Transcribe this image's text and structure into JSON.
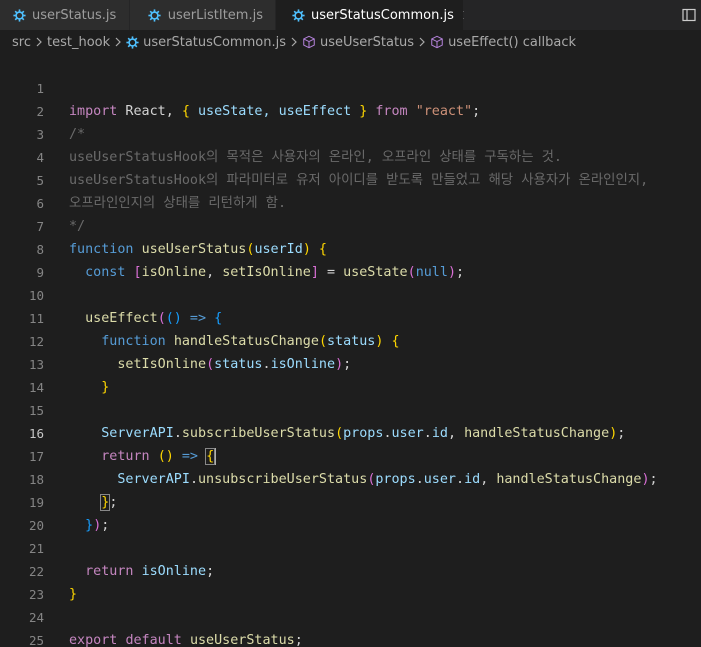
{
  "tabs": [
    {
      "label": "userStatus.js",
      "active": false
    },
    {
      "label": "userListItem.js",
      "active": false
    },
    {
      "label": "userStatusCommon.js",
      "active": true
    }
  ],
  "breadcrumb": {
    "items": [
      "src",
      "test_hook",
      "userStatusCommon.js",
      "useUserStatus",
      "useEffect() callback"
    ]
  },
  "editor": {
    "current_line": 16,
    "line_numbers": [
      "1",
      "2",
      "3",
      "4",
      "5",
      "6",
      "7",
      "8",
      "9",
      "10",
      "11",
      "12",
      "13",
      "14",
      "15",
      "16",
      "17",
      "18",
      "19",
      "20",
      "21",
      "22",
      "23",
      "24",
      "25"
    ],
    "lines": {
      "l1": {
        "a": "import",
        "b": " React, ",
        "c": "{",
        "d": " useState, useEffect ",
        "e": "}",
        "f": " from ",
        "g": "\"react\"",
        "h": ";"
      },
      "l2": "/*",
      "l3": "useUserStatusHook의 목적은 사용자의 온라인, 오프라인 상태를 구독하는 것.",
      "l4": "useUserStatusHook의 파라미터로 유저 아이디를 받도록 만들었고 해당 사용자가 온라인인지,",
      "l5": "오프라인인지의 상태를 리턴하게 함.",
      "l6": "*/",
      "l7": {
        "a": "function",
        "b": " ",
        "c": "useUserStatus",
        "d": "(",
        "e": "userId",
        "f": ")",
        "g": " {"
      },
      "l8": {
        "a": "  ",
        "b": "const",
        "c": " ",
        "d": "[",
        "e": "isOnline",
        "f": ", ",
        "g": "setIsOnline",
        "h": "]",
        "i": " = ",
        "j": "useState",
        "k": "(",
        "l": "null",
        "m": ")",
        "n": ";"
      },
      "l10": {
        "a": "  ",
        "b": "useEffect",
        "c": "(",
        "d": "()",
        "e": " => ",
        "f": "{"
      },
      "l11": {
        "a": "    ",
        "b": "function",
        "c": " ",
        "d": "handleStatusChange",
        "e": "(",
        "f": "status",
        "g": ")",
        "h": " ",
        "i": "{"
      },
      "l12": {
        "a": "      ",
        "b": "setIsOnline",
        "c": "(",
        "d": "status",
        "e": ".",
        "f": "isOnline",
        "g": ")",
        "h": ";"
      },
      "l13": {
        "a": "    ",
        "b": "}"
      },
      "l15": {
        "a": "    ",
        "b": "ServerAPI",
        "c": ".",
        "d": "subscribeUserStatus",
        "e": "(",
        "f": "props",
        "g": ".",
        "h": "user",
        "i": ".",
        "j": "id",
        "k": ", ",
        "l": "handleStatusChange",
        "m": ")",
        "n": ";"
      },
      "l16": {
        "a": "    ",
        "b": "return",
        "c": " ",
        "d": "()",
        "e": " => ",
        "f": "{"
      },
      "l17": {
        "a": "      ",
        "b": "ServerAPI",
        "c": ".",
        "d": "unsubscribeUserStatus",
        "e": "(",
        "f": "props",
        "g": ".",
        "h": "user",
        "i": ".",
        "j": "id",
        "k": ", ",
        "l": "handleStatusChange",
        "m": ")",
        "n": ";"
      },
      "l18": {
        "a": "    ",
        "b": "}",
        "c": ";"
      },
      "l19": {
        "a": "  ",
        "b": "}",
        "c": ")",
        "d": ";"
      },
      "l21": {
        "a": "  ",
        "b": "return",
        "c": " ",
        "d": "isOnline",
        "e": ";"
      },
      "l22": "}",
      "l24": {
        "a": "export",
        "b": " ",
        "c": "default",
        "d": " ",
        "e": "useUserStatus",
        "f": ";"
      }
    }
  },
  "colors": {
    "background": "#1e1e1e",
    "keyword": "#569cd6",
    "control_keyword": "#c586c0",
    "function": "#dcdcaa",
    "variable": "#9cdcfe",
    "string": "#ce9178",
    "comment": "#6a6a6a",
    "bracket1": "#ffd700",
    "bracket2": "#da70d6",
    "bracket3": "#179fff",
    "js_icon": "#4fc1ff"
  },
  "icons": {
    "file_icon": "js-gear-icon",
    "close_icon": "close-icon",
    "layout_icon": "split-editor-icon",
    "symbol_icon": "cube-symbol-icon",
    "chevron_icon": "chevron-right-icon"
  }
}
